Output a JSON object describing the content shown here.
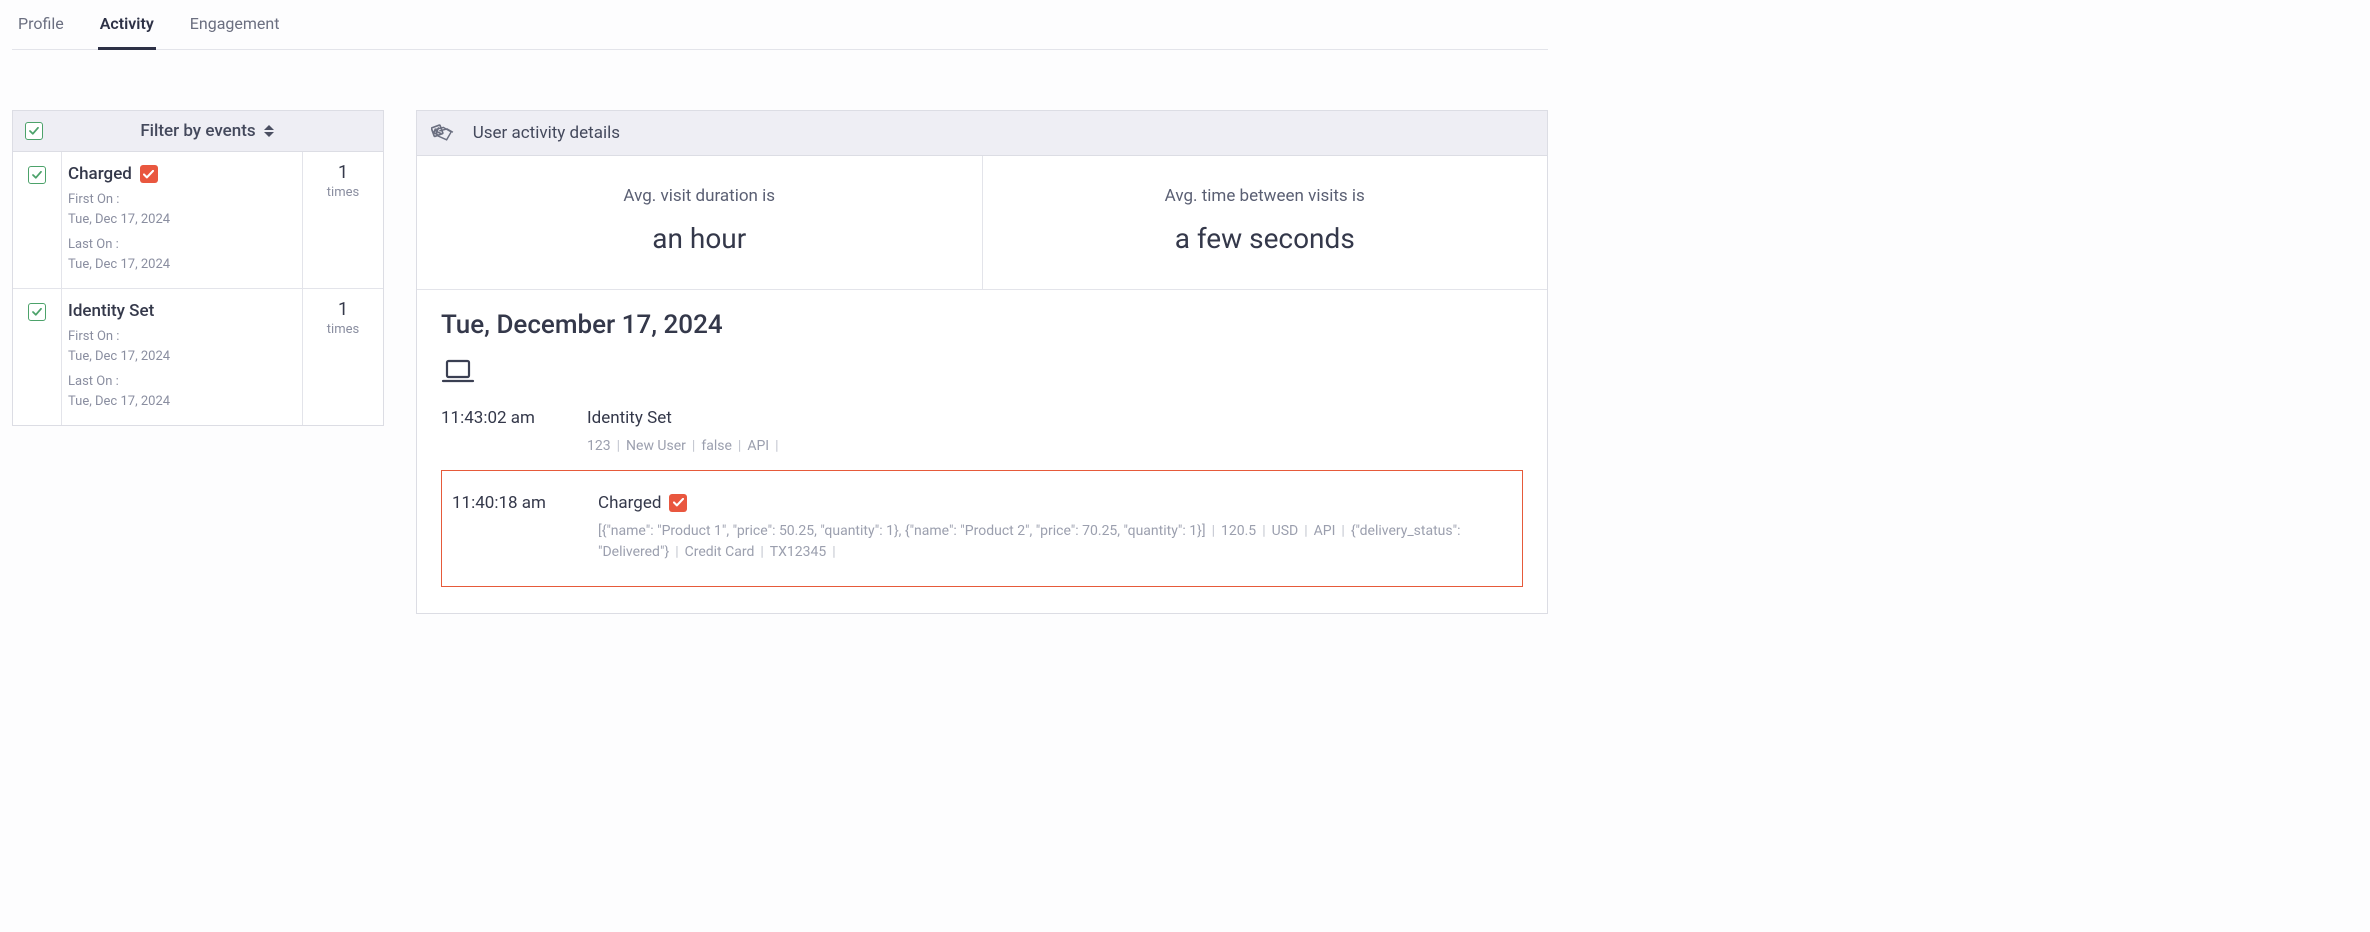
{
  "tabs": {
    "profile": "Profile",
    "activity": "Activity",
    "engagement": "Engagement"
  },
  "filter": {
    "header_title": "Filter by events",
    "items": [
      {
        "name": "Charged",
        "badge": true,
        "first_on_label": "First On :",
        "first_on_value": "Tue, Dec 17, 2024",
        "last_on_label": "Last On :",
        "last_on_value": "Tue, Dec 17, 2024",
        "count": "1",
        "count_label": "times"
      },
      {
        "name": "Identity Set",
        "badge": false,
        "first_on_label": "First On :",
        "first_on_value": "Tue, Dec 17, 2024",
        "last_on_label": "Last On :",
        "last_on_value": "Tue, Dec 17, 2024",
        "count": "1",
        "count_label": "times"
      }
    ]
  },
  "details": {
    "header_title": "User activity details",
    "stats": [
      {
        "label": "Avg. visit duration is",
        "value": "an hour"
      },
      {
        "label": "Avg. time between visits is",
        "value": "a few seconds"
      }
    ],
    "date": "Tue, December 17, 2024",
    "events": [
      {
        "time": "11:43:02 am",
        "title": "Identity Set",
        "badge": false,
        "detail_parts": [
          "123",
          "New User",
          "false",
          "API",
          ""
        ]
      },
      {
        "time": "11:40:18 am",
        "title": "Charged",
        "badge": true,
        "detail_parts": [
          "[{\"name\": \"Product 1\", \"price\": 50.25, \"quantity\": 1}, {\"name\": \"Product 2\", \"price\": 70.25, \"quantity\": 1}]",
          "120.5",
          "USD",
          "API",
          "{\"delivery_status\": \"Delivered\"}",
          "Credit Card",
          "TX12345",
          ""
        ],
        "highlighted": true
      }
    ]
  }
}
